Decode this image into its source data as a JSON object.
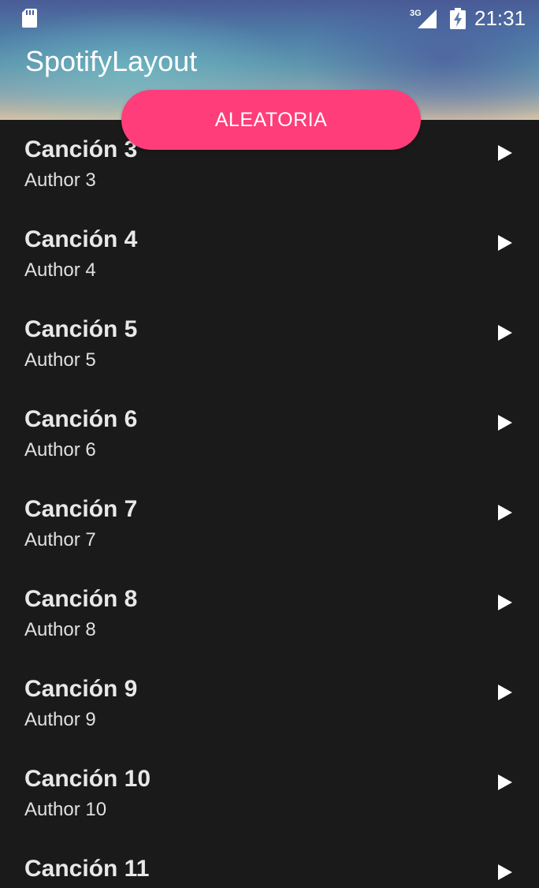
{
  "status_bar": {
    "network_label": "3G",
    "time": "21:31"
  },
  "app_bar": {
    "title": "SpotifyLayout"
  },
  "shuffle_button": {
    "label": "ALEATORIA"
  },
  "songs": [
    {
      "title": "Canción 3",
      "author": "Author 3"
    },
    {
      "title": "Canción 4",
      "author": "Author 4"
    },
    {
      "title": "Canción 5",
      "author": "Author 5"
    },
    {
      "title": "Canción 6",
      "author": "Author 6"
    },
    {
      "title": "Canción 7",
      "author": "Author 7"
    },
    {
      "title": "Canción 8",
      "author": "Author 8"
    },
    {
      "title": "Canción 9",
      "author": "Author 9"
    },
    {
      "title": "Canción 10",
      "author": "Author 10"
    },
    {
      "title": "Canción 11",
      "author": ""
    }
  ],
  "icons": {
    "sd_card": "sd-card-icon",
    "network": "signal-icon",
    "battery": "battery-charging-icon",
    "play": "play-icon"
  },
  "colors": {
    "accent": "#ff3d7a",
    "background": "#1a1a1a",
    "text": "#e8e8e8"
  }
}
